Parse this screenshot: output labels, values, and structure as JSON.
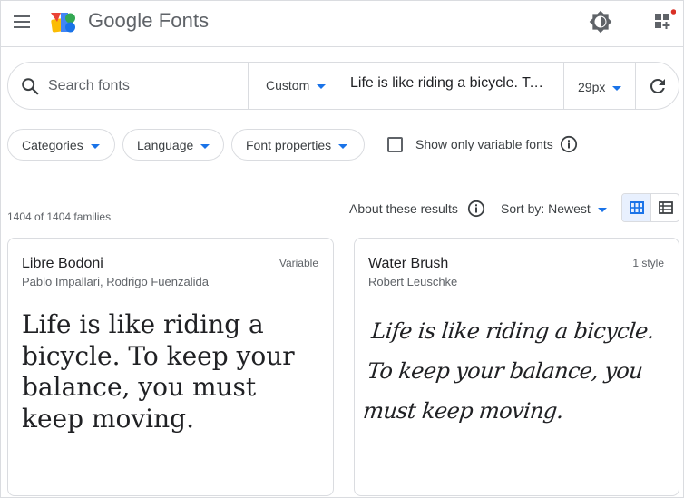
{
  "header": {
    "brand": "Google Fonts",
    "icons": {
      "menu": "hamburger-menu-icon",
      "logo": "google-fonts-logo",
      "theme": "brightness-icon",
      "apps": "dashboard-customize-icon"
    }
  },
  "search": {
    "placeholder": "Search fonts",
    "preset": "Custom",
    "preview_text": "Life is like riding a bicycle. To keep your balance, you must keep moving.",
    "size": "29px"
  },
  "filters": {
    "categories": "Categories",
    "language": "Language",
    "font_properties": "Font properties",
    "variable_only": "Show only variable fonts"
  },
  "results": {
    "count": "1404 of 1404 families",
    "about": "About these results",
    "sort": "Sort by: Newest"
  },
  "cards": [
    {
      "name": "Libre Bodoni",
      "author": "Pablo Impallari, Rodrigo Fuenzalida",
      "meta": "Variable",
      "sample": "Life is like riding a bicycle. To keep your balance, you must keep moving."
    },
    {
      "name": "Water Brush",
      "author": "Robert Leuschke",
      "meta": "1 style",
      "sample": "Life is like riding a bicycle. To keep your balance, you must keep moving."
    }
  ],
  "colors": {
    "accent": "#1a73e8",
    "text": "#202124",
    "secondary_text": "#5f6368",
    "border": "#dadce0",
    "notification": "#d93025"
  }
}
